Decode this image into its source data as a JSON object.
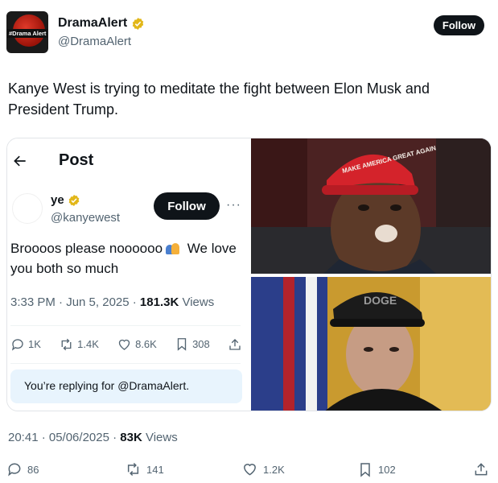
{
  "post": {
    "author_name": "DramaAlert",
    "author_handle": "@DramaAlert",
    "avatar_tag": "#Drama Alert",
    "follow_label": "Follow",
    "text": "Kanye West is trying to meditate the fight between Elon Musk and President Trump.",
    "timestamp": "20:41 · 05/06/2025 · ",
    "views_count": "83K",
    "views_label": " Views",
    "actions": {
      "replies": "86",
      "reposts": "141",
      "likes": "1.2K",
      "bookmarks": "102"
    }
  },
  "embed": {
    "header_title": "Post",
    "author_name": "ye",
    "author_handle": "@kanyewest",
    "follow_label": "Follow",
    "more_label": "···",
    "text_before": "Broooos please noooooo",
    "text_after": "We love you both so much",
    "meta_time": "3:33 PM · Jun 5, 2025 · ",
    "views_count": "181.3K",
    "views_label": " Views",
    "actions": {
      "replies": "1K",
      "reposts": "1.4K",
      "likes": "8.6K",
      "bookmarks": "308"
    },
    "reply_notice": "You’re replying for @DramaAlert."
  },
  "photos": {
    "top_caption": "MAKE AMERICA GREAT AGAIN",
    "bottom_caption": "DOGE"
  },
  "colors": {
    "text": "#0f1419",
    "muted": "#536471",
    "verified": "#e2b719",
    "reply_bg": "#e8f4fd"
  },
  "icons": [
    "reply-icon",
    "repost-icon",
    "like-icon",
    "bookmark-icon",
    "share-icon",
    "verified-badge-icon",
    "back-arrow-icon"
  ]
}
